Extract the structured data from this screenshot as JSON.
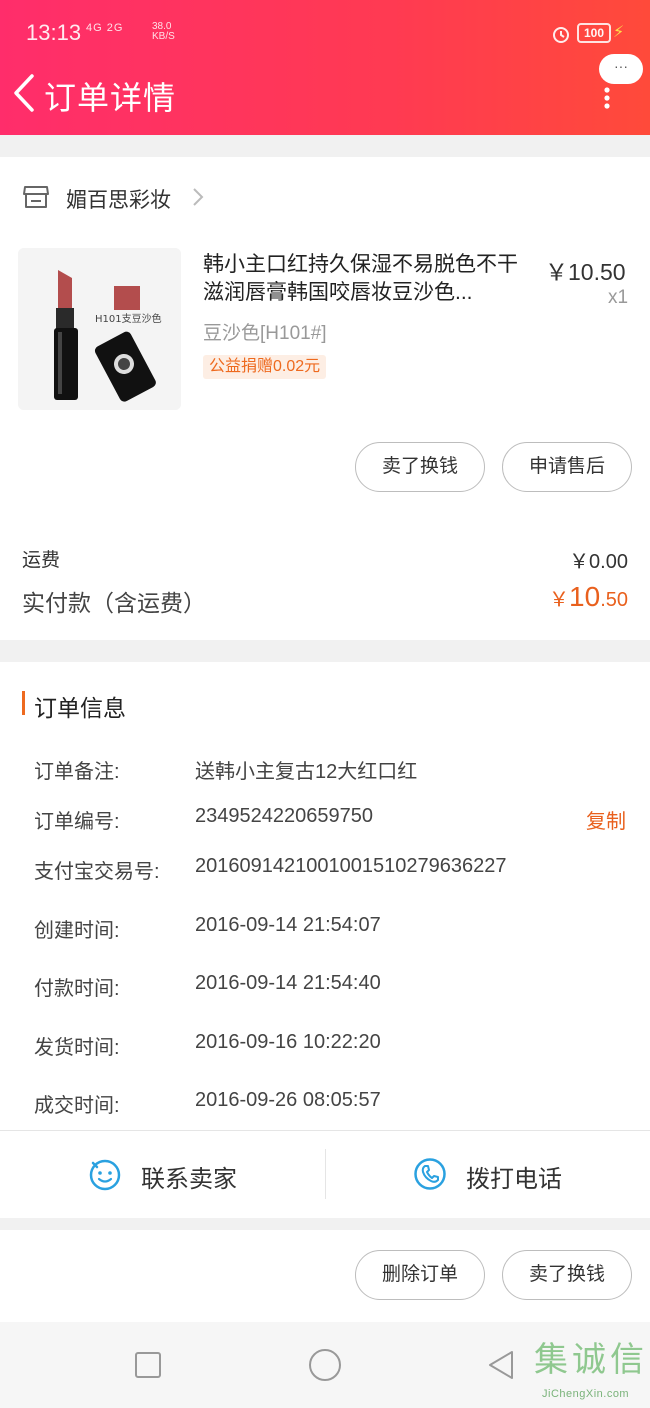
{
  "status_bar": {
    "time": "13:13",
    "signal": "4G 2G",
    "speed_value": "38.0",
    "speed_unit": "KB/S",
    "battery": "100"
  },
  "nav": {
    "title": "订单详情",
    "more_label": "···"
  },
  "shop": {
    "name": "媚百思彩妆"
  },
  "product": {
    "title": "韩小主口红持久保湿不易脱色不干滋润唇膏韩国咬唇妆豆沙色...",
    "price": "￥10.50",
    "quantity": "x1",
    "variant": "豆沙色[H101#]",
    "charity_tag": "公益捐赠0.02元",
    "image_label": "H101支豆沙色"
  },
  "item_actions": {
    "sell_label": "卖了换钱",
    "aftersale_label": "申请售后"
  },
  "totals": {
    "shipping_label": "运费",
    "shipping_value": "￥0.00",
    "paid_label": "实付款（含运费）",
    "paid_currency": "￥",
    "paid_int": "10",
    "paid_dec": ".50"
  },
  "order_info": {
    "title": "订单信息",
    "copy_label": "复制",
    "rows": [
      {
        "key": "订单备注:",
        "value": "送韩小主复古12大红口红"
      },
      {
        "key": "订单编号:",
        "value": "2349524220659750"
      },
      {
        "key": "支付宝交易号:",
        "value": "2016091421001001510279636227"
      },
      {
        "key": "创建时间:",
        "value": "2016-09-14 21:54:07"
      },
      {
        "key": "付款时间:",
        "value": "2016-09-14 21:54:40"
      },
      {
        "key": "发货时间:",
        "value": "2016-09-16 10:22:20"
      },
      {
        "key": "成交时间:",
        "value": "2016-09-26 08:05:57"
      }
    ]
  },
  "contact": {
    "seller_label": "联系卖家",
    "phone_label": "拨打电话"
  },
  "bottom_actions": {
    "delete_label": "删除订单",
    "sell_label": "卖了换钱"
  },
  "watermark": {
    "chars": [
      "集",
      "诚",
      "信"
    ],
    "sub": "JiChengXin.com"
  },
  "colors": {
    "header_start": "#ff2d6b",
    "header_end": "#ff4a3a",
    "accent_orange": "#e9601d"
  }
}
